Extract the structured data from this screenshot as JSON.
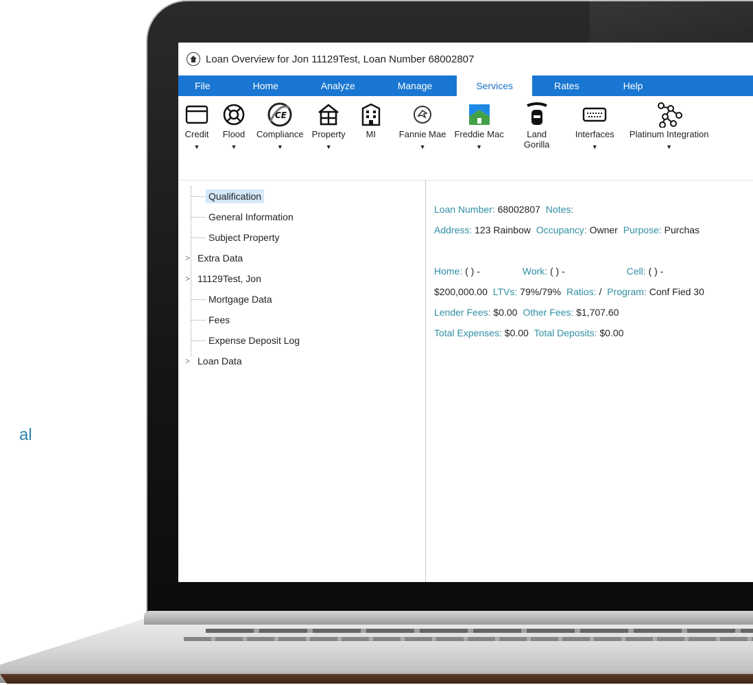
{
  "side_text": "al",
  "window": {
    "title": "Loan Overview for Jon 11129Test, Loan Number 68002807"
  },
  "menu": {
    "items": [
      "File",
      "Home",
      "Analyze",
      "Manage",
      "Services",
      "Rates",
      "Help"
    ],
    "active": "Services"
  },
  "ribbon": {
    "buttons": [
      {
        "label": "Credit",
        "icon": "card-icon",
        "caret": true
      },
      {
        "label": "Flood",
        "icon": "lifebuoy-icon",
        "caret": true
      },
      {
        "label": "Compliance",
        "icon": "ce-compliance-icon",
        "caret": true
      },
      {
        "label": "Property",
        "icon": "house-icon",
        "caret": true
      },
      {
        "label": "MI",
        "icon": "building-icon",
        "caret": false
      },
      {
        "label": "Fannie Mae",
        "icon": "fannie-mae-icon",
        "caret": true
      },
      {
        "label": "Freddie Mac",
        "icon": "freddie-mac-icon",
        "caret": true
      },
      {
        "label": "Land Gorilla",
        "icon": "land-gorilla-icon",
        "caret": false
      },
      {
        "label": "Interfaces",
        "icon": "keyboard-icon",
        "caret": true
      },
      {
        "label": "Platinum Integration",
        "icon": "network-icon",
        "caret": true
      }
    ],
    "caret_glyph": "▼"
  },
  "tree": {
    "items": [
      {
        "label": "Qualification",
        "expandable": false,
        "selected": true
      },
      {
        "label": "General Information",
        "expandable": false,
        "selected": false
      },
      {
        "label": "Subject Property",
        "expandable": false,
        "selected": false
      },
      {
        "label": "Extra Data",
        "expandable": true,
        "selected": false
      },
      {
        "label": "11129Test, Jon",
        "expandable": true,
        "selected": false
      },
      {
        "label": "Mortgage Data",
        "expandable": false,
        "selected": false
      },
      {
        "label": "Fees",
        "expandable": false,
        "selected": false
      },
      {
        "label": "Expense Deposit Log",
        "expandable": false,
        "selected": false
      },
      {
        "label": "Loan Data",
        "expandable": true,
        "selected": false
      }
    ],
    "expand_glyph": ">"
  },
  "details": {
    "loan_number_label": "Loan Number:",
    "loan_number": "68002807",
    "notes_label": "Notes:",
    "address_label": "Address:",
    "address": "123 Rainbow",
    "occupancy_label": "Occupancy:",
    "occupancy": "Owner",
    "purpose_label": "Purpose:",
    "purpose": "Purchas",
    "home_label": "Home:",
    "home_value": "( ) -",
    "work_label": "Work:",
    "work_value": "( ) -",
    "cell_label": "Cell:",
    "cell_value": "( ) -",
    "amount": "$200,000.00",
    "ltvs_label": "LTVs:",
    "ltvs": "79%/79%",
    "ratios_label": "Ratios:",
    "ratios": "/",
    "program_label": "Program:",
    "program": "Conf Fied 30",
    "lender_fees_label": "Lender Fees:",
    "lender_fees": "$0.00",
    "other_fees_label": "Other Fees:",
    "other_fees": "$1,707.60",
    "total_expenses_label": "Total Expenses:",
    "total_expenses": "$0.00",
    "total_deposits_label": "Total Deposits:",
    "total_deposits": "$0.00"
  },
  "colors": {
    "menu_bar": "#1976d2",
    "label_teal": "#2f8fa3",
    "selected_tree": "#d4e8f7",
    "side_text": "#2a82a8"
  }
}
